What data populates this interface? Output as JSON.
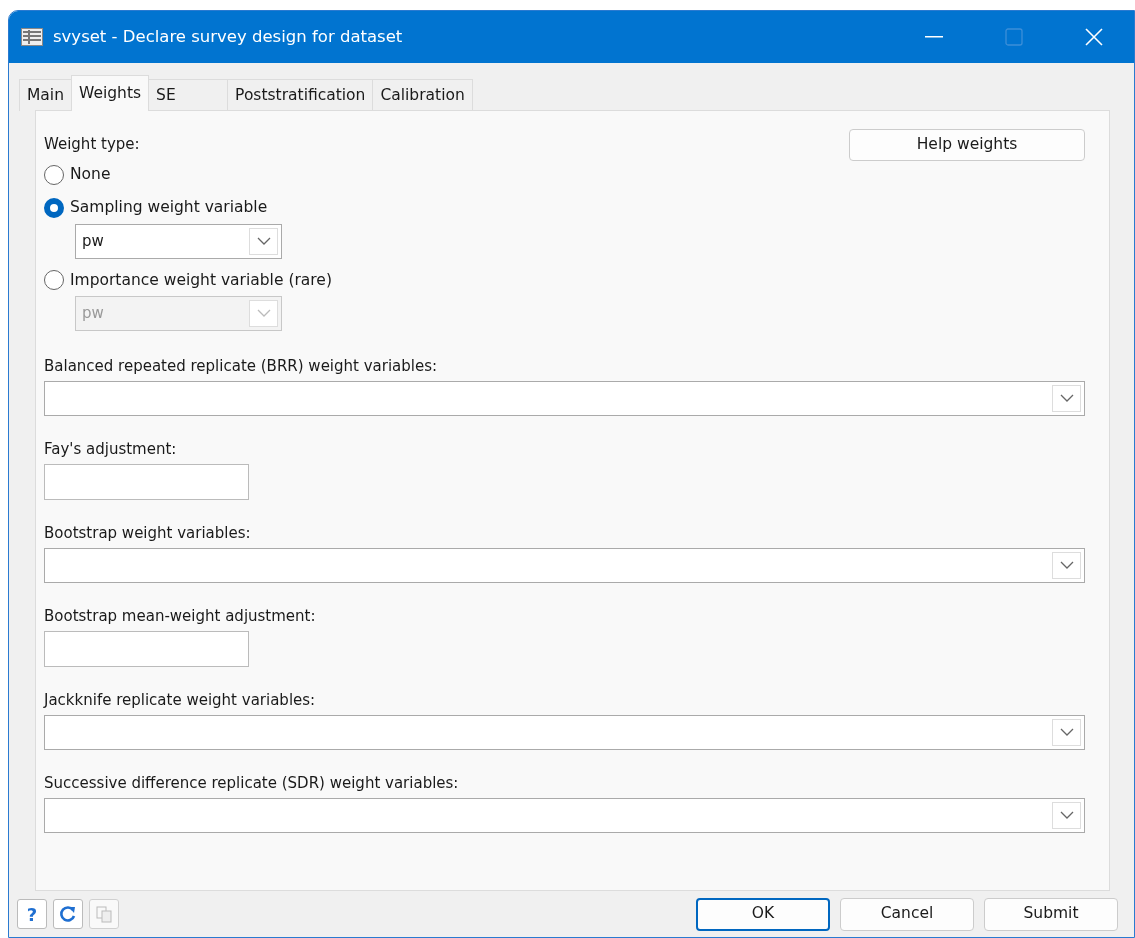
{
  "window": {
    "title": "svyset - Declare survey design for dataset",
    "maximize_disabled": true
  },
  "tabs": [
    {
      "label": "Main",
      "selected": false
    },
    {
      "label": "Weights",
      "selected": true
    },
    {
      "label": "SE",
      "selected": false
    },
    {
      "label": "Poststratification",
      "selected": false
    },
    {
      "label": "Calibration",
      "selected": false
    }
  ],
  "help_button": "Help weights",
  "weight_type": {
    "label": "Weight type:",
    "options": [
      {
        "label": "None",
        "selected": false
      },
      {
        "label": "Sampling weight variable",
        "selected": true,
        "value": "pw",
        "disabled": false
      },
      {
        "label": "Importance weight variable (rare)",
        "selected": false,
        "value": "pw",
        "disabled": true
      }
    ]
  },
  "fields": [
    {
      "kind": "combo",
      "label": "Balanced repeated replicate (BRR) weight variables:"
    },
    {
      "kind": "text",
      "label": "Fay's adjustment:"
    },
    {
      "kind": "combo",
      "label": "Bootstrap weight variables:"
    },
    {
      "kind": "text",
      "label": "Bootstrap mean-weight adjustment:"
    },
    {
      "kind": "combo",
      "label": "Jackknife replicate weight variables:"
    },
    {
      "kind": "combo",
      "label": "Successive difference replicate (SDR) weight variables:"
    }
  ],
  "footer": {
    "tools": [
      {
        "kind": "help",
        "label": "?",
        "disabled": false
      },
      {
        "kind": "reset",
        "disabled": false
      },
      {
        "kind": "copy",
        "disabled": true
      }
    ],
    "buttons": [
      {
        "label": "OK",
        "default": true
      },
      {
        "label": "Cancel",
        "default": false
      },
      {
        "label": "Submit",
        "default": false
      }
    ]
  }
}
